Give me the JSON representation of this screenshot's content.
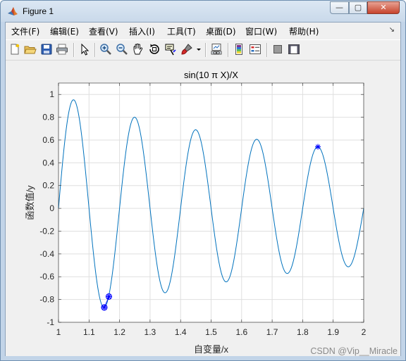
{
  "window": {
    "title": "Figure 1",
    "controls": {
      "minimize": "—",
      "maximize": "▢",
      "close": "✕"
    }
  },
  "menu": [
    {
      "label": "文件(F)"
    },
    {
      "label": "编辑(E)"
    },
    {
      "label": "查看(V)"
    },
    {
      "label": "插入(I)"
    },
    {
      "label": "工具(T)"
    },
    {
      "label": "桌面(D)"
    },
    {
      "label": "窗口(W)"
    },
    {
      "label": "帮助(H)"
    }
  ],
  "toolbar": [
    "new-figure-icon",
    "open-file-icon",
    "save-icon",
    "print-icon",
    "edit-plot-icon",
    "zoom-in-icon",
    "zoom-out-icon",
    "pan-icon",
    "rotate-3d-icon",
    "data-cursor-icon",
    "brush-icon",
    "brush-dropdown-icon",
    "link-plot-icon",
    "insert-colorbar-icon",
    "insert-legend-icon",
    "hide-plot-tools-icon",
    "show-plot-tools-icon"
  ],
  "chart_data": {
    "type": "line",
    "title": "sin(10 π X)/X",
    "xlabel": "自变量/x",
    "ylabel": "函数值/y",
    "xlim": [
      1,
      2
    ],
    "ylim": [
      -1,
      1.1
    ],
    "xticks": [
      "1",
      "1.1",
      "1.2",
      "1.3",
      "1.4",
      "1.5",
      "1.6",
      "1.7",
      "1.8",
      "1.9",
      "2"
    ],
    "yticks": [
      "-1",
      "-0.8",
      "-0.6",
      "-0.4",
      "-0.2",
      "0",
      "0.2",
      "0.4",
      "0.6",
      "0.8",
      "1"
    ],
    "grid": true,
    "series": [
      {
        "function": "sin(10*pi*x)/x",
        "x_range": [
          1,
          2
        ],
        "color": "#0072bd"
      },
      {
        "marker": "circle",
        "color": "#0000ff",
        "points": [
          [
            1.15,
            -0.8696
          ],
          [
            1.165,
            -0.7741
          ]
        ]
      },
      {
        "marker": "star",
        "color": "#0000ff",
        "points": [
          [
            1.15,
            -0.8696
          ],
          [
            1.165,
            -0.7741
          ],
          [
            1.85,
            0.5405
          ]
        ]
      }
    ],
    "watermark": "CSDN @Vip__Miracle",
    "colors": {
      "line": "#0072bd",
      "marker": "#0000ff",
      "axes_bg": "#ffffff",
      "figure_bg": "#f0f0f0"
    }
  }
}
